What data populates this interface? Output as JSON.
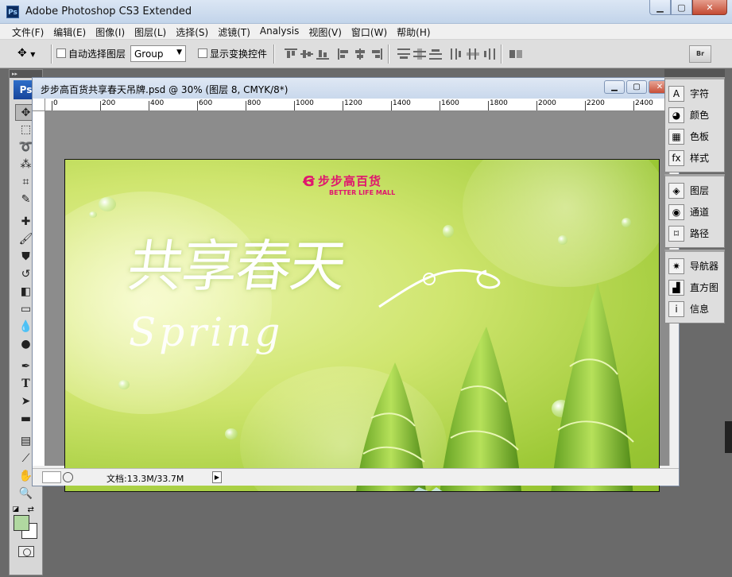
{
  "window": {
    "title": "Adobe Photoshop CS3 Extended",
    "app_icon": "Ps",
    "buttons": [
      "minimize",
      "maximize",
      "close"
    ]
  },
  "menu": [
    "文件(F)",
    "编辑(E)",
    "图像(I)",
    "图层(L)",
    "选择(S)",
    "滤镜(T)",
    "Analysis",
    "视图(V)",
    "窗口(W)",
    "帮助(H)"
  ],
  "options": {
    "auto_select_label": "自动选择图层",
    "auto_select_value": "Group",
    "show_transform_label": "显示变换控件",
    "bridge_label": "Br"
  },
  "toolbox": {
    "logo": "Ps",
    "fg_color": "#b0d8a0",
    "bg_color": "#ffffff"
  },
  "document": {
    "title": "步步高百货共享春天吊牌.psd @ 30% (图层 8, CMYK/8*)",
    "ruler_ticks": [
      "0",
      "200",
      "400",
      "600",
      "800",
      "1000",
      "1200",
      "1400",
      "1600",
      "1800",
      "2000",
      "2200",
      "2400"
    ],
    "status_text": "文档:13.3M/33.7M"
  },
  "poster": {
    "brand_zh": "步步高百货",
    "brand_en": "BETTER LIFE MALL",
    "headline": "共享春天",
    "subtitle": "Spring"
  },
  "panels": [
    {
      "group": 1,
      "items": [
        {
          "icon": "character-icon",
          "glyph": "A",
          "label": "字符"
        },
        {
          "icon": "color-icon",
          "glyph": "◕",
          "label": "颜色"
        },
        {
          "icon": "swatches-icon",
          "glyph": "▦",
          "label": "色板"
        },
        {
          "icon": "styles-icon",
          "glyph": "fx",
          "label": "样式"
        }
      ]
    },
    {
      "group": 2,
      "items": [
        {
          "icon": "layers-icon",
          "glyph": "◈",
          "label": "图层"
        },
        {
          "icon": "channels-icon",
          "glyph": "◉",
          "label": "通道"
        },
        {
          "icon": "paths-icon",
          "glyph": "⌑",
          "label": "路径"
        }
      ]
    },
    {
      "group": 3,
      "items": [
        {
          "icon": "navigator-icon",
          "glyph": "✷",
          "label": "导航器"
        },
        {
          "icon": "histogram-icon",
          "glyph": "▟",
          "label": "直方图"
        },
        {
          "icon": "info-icon",
          "glyph": "i",
          "label": "信息"
        }
      ]
    }
  ]
}
